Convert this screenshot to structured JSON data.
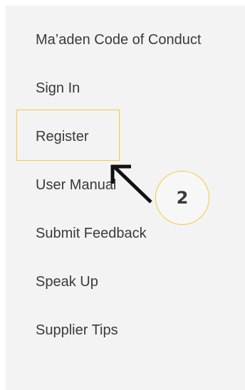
{
  "menu": {
    "items": [
      {
        "label": "Ma’aden Code of Conduct"
      },
      {
        "label": "Sign In"
      },
      {
        "label": "Register"
      },
      {
        "label": "User Manual"
      },
      {
        "label": "Submit Feedback"
      },
      {
        "label": "Speak Up"
      },
      {
        "label": "Supplier Tips"
      }
    ]
  },
  "annotation": {
    "step_number": "2",
    "highlight_color": "#f5c842",
    "arrow_icon": "arrow-up-left-icon"
  },
  "colors": {
    "panel_background": "#f3f3f3",
    "text": "#3a3a3a"
  }
}
